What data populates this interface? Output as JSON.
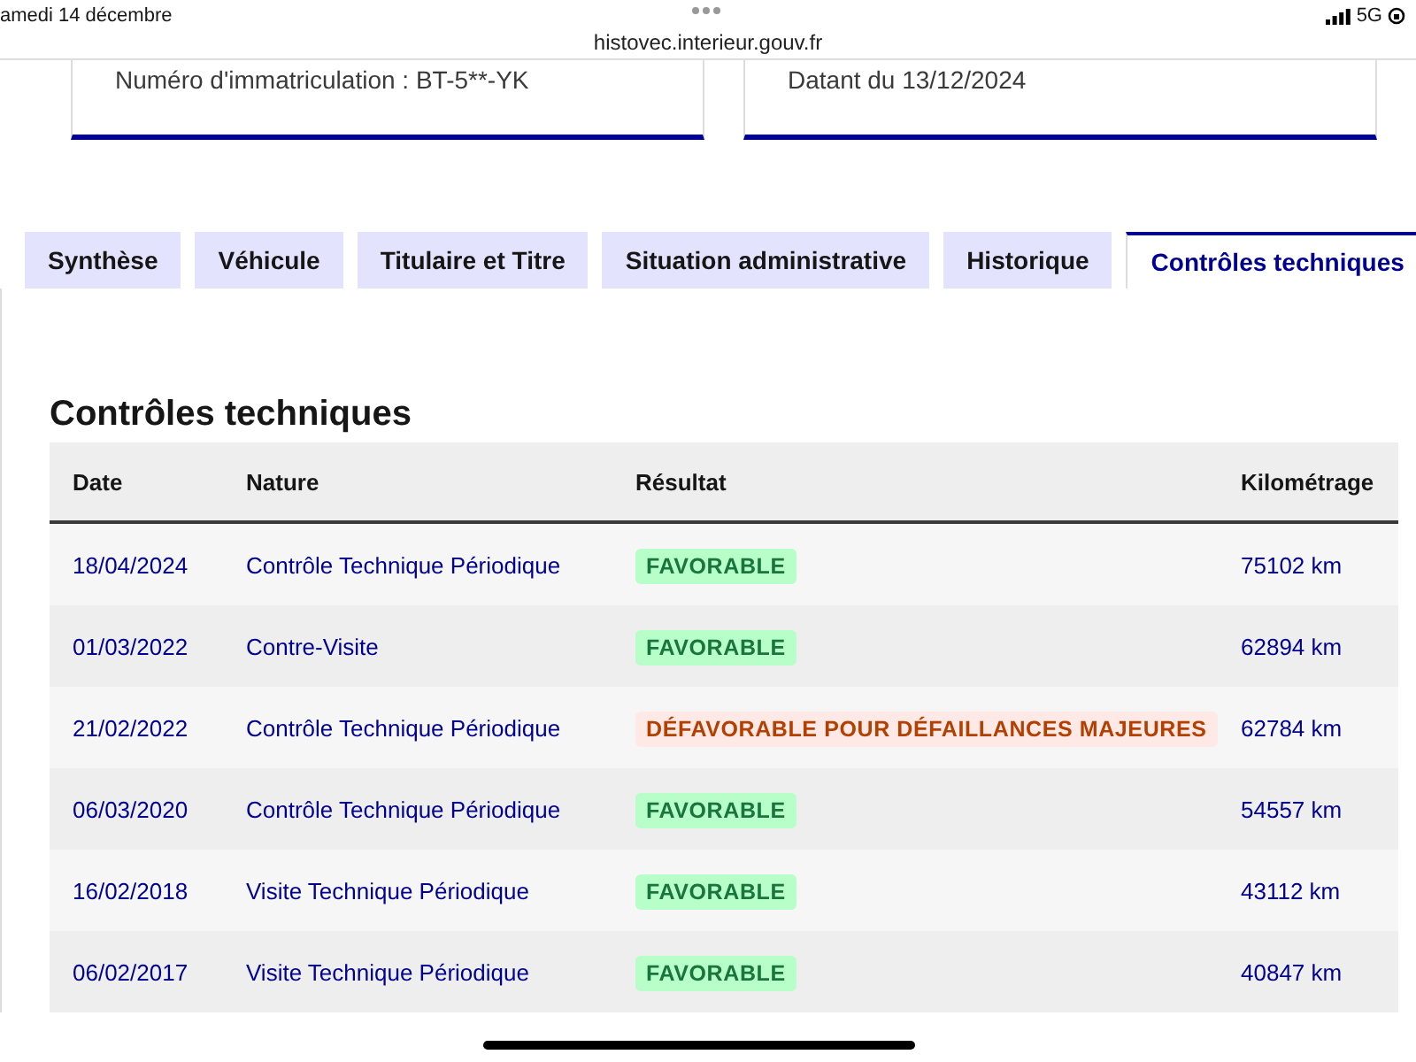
{
  "status_bar": {
    "date": "amedi 14 décembre",
    "url": "histovec.interieur.gouv.fr",
    "network": "5G"
  },
  "cards": [
    {
      "text": "Numéro d'immatriculation : BT-5**-YK"
    },
    {
      "text": "Datant du 13/12/2024"
    }
  ],
  "tabs": [
    {
      "label": "Synthèse",
      "selected": false
    },
    {
      "label": "Véhicule",
      "selected": false
    },
    {
      "label": "Titulaire et Titre",
      "selected": false
    },
    {
      "label": "Situation administrative",
      "selected": false
    },
    {
      "label": "Historique",
      "selected": false
    },
    {
      "label": "Contrôles techniques",
      "selected": true
    }
  ],
  "section": {
    "title": "Contrôles techniques",
    "table": {
      "columns": [
        "Date",
        "Nature",
        "Résultat",
        "Kilométrage"
      ],
      "rows": [
        {
          "date": "18/04/2024",
          "nature": "Contrôle Technique Périodique",
          "result": "FAVORABLE",
          "kind": "success",
          "km": "75102 km"
        },
        {
          "date": "01/03/2022",
          "nature": "Contre-Visite",
          "result": "FAVORABLE",
          "kind": "success",
          "km": "62894 km"
        },
        {
          "date": "21/02/2022",
          "nature": "Contrôle Technique Périodique",
          "result": "DÉFAVORABLE POUR DÉFAILLANCES MAJEURES",
          "kind": "error",
          "km": "62784 km"
        },
        {
          "date": "06/03/2020",
          "nature": "Contrôle Technique Périodique",
          "result": "FAVORABLE",
          "kind": "success",
          "km": "54557 km"
        },
        {
          "date": "16/02/2018",
          "nature": "Visite Technique Périodique",
          "result": "FAVORABLE",
          "kind": "success",
          "km": "43112 km"
        },
        {
          "date": "06/02/2017",
          "nature": "Visite Technique Périodique",
          "result": "FAVORABLE",
          "kind": "success",
          "km": "40847 km"
        }
      ]
    }
  }
}
